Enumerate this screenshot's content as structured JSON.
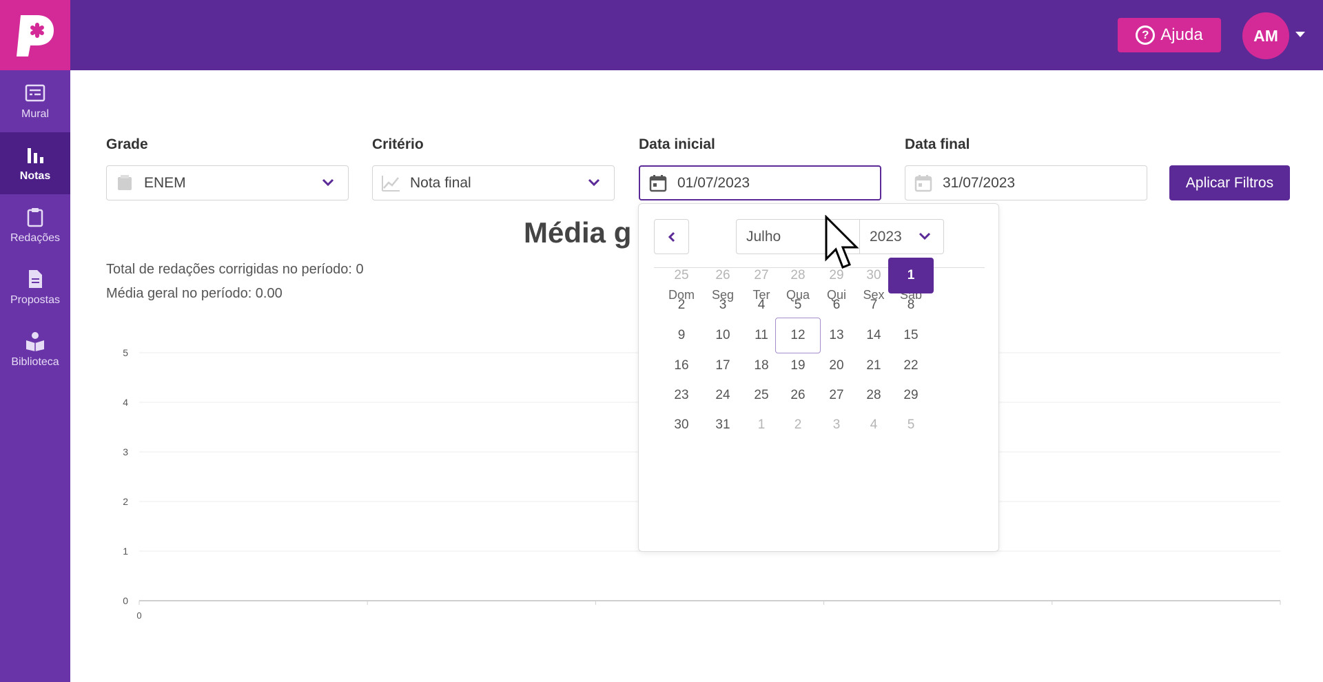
{
  "colors": {
    "brand_purple": "#5b2a96",
    "brand_pink": "#d42a97",
    "sidebar": "#6a34a9",
    "sidebar_active": "#4c1f86"
  },
  "header": {
    "logo": "P",
    "help_label": "Ajuda",
    "avatar_initials": "AM"
  },
  "sidebar": {
    "items": [
      {
        "label": "Mural",
        "icon": "board-icon"
      },
      {
        "label": "Notas",
        "icon": "bar-chart-icon",
        "active": true
      },
      {
        "label": "Redações",
        "icon": "clipboard-icon"
      },
      {
        "label": "Propostas",
        "icon": "document-icon"
      },
      {
        "label": "Biblioteca",
        "icon": "reader-icon"
      }
    ]
  },
  "filters": {
    "grade": {
      "label": "Grade",
      "value": "ENEM"
    },
    "criterio": {
      "label": "Critério",
      "value": "Nota final"
    },
    "data_inicial": {
      "label": "Data inicial",
      "value": "01/07/2023"
    },
    "data_final": {
      "label": "Data final",
      "value": "31/07/2023"
    },
    "apply_label": "Aplicar Filtros"
  },
  "main": {
    "chart_title": "Média g",
    "total_label": "Total de redações corrigidas no período: 0",
    "media_label": "Média geral no período: 0.00"
  },
  "chart_data": {
    "type": "line",
    "title": "",
    "xlabel": "",
    "ylabel": "",
    "ylim": [
      0,
      5
    ],
    "y_ticks": [
      "0",
      "1",
      "2",
      "3",
      "4",
      "5"
    ],
    "x_tick_labels": [
      "0"
    ],
    "grid": true,
    "series": []
  },
  "datepicker": {
    "month": "Julho",
    "year": "2023",
    "weekdays": [
      "Dom",
      "Seg",
      "Ter",
      "Qua",
      "Qui",
      "Sex",
      "Sáb"
    ],
    "weeks": [
      [
        [
          "25",
          "muted"
        ],
        [
          "26",
          "muted"
        ],
        [
          "27",
          "muted"
        ],
        [
          "28",
          "muted"
        ],
        [
          "29",
          "muted"
        ],
        [
          "30",
          "muted"
        ],
        [
          "1",
          "selected"
        ]
      ],
      [
        [
          "2",
          ""
        ],
        [
          "3",
          ""
        ],
        [
          "4",
          ""
        ],
        [
          "5",
          ""
        ],
        [
          "6",
          ""
        ],
        [
          "7",
          ""
        ],
        [
          "8",
          ""
        ]
      ],
      [
        [
          "9",
          ""
        ],
        [
          "10",
          ""
        ],
        [
          "11",
          ""
        ],
        [
          "12",
          "today"
        ],
        [
          "13",
          ""
        ],
        [
          "14",
          ""
        ],
        [
          "15",
          ""
        ]
      ],
      [
        [
          "16",
          ""
        ],
        [
          "17",
          ""
        ],
        [
          "18",
          ""
        ],
        [
          "19",
          ""
        ],
        [
          "20",
          ""
        ],
        [
          "21",
          ""
        ],
        [
          "22",
          ""
        ]
      ],
      [
        [
          "23",
          ""
        ],
        [
          "24",
          ""
        ],
        [
          "25",
          ""
        ],
        [
          "26",
          ""
        ],
        [
          "27",
          ""
        ],
        [
          "28",
          ""
        ],
        [
          "29",
          ""
        ]
      ],
      [
        [
          "30",
          ""
        ],
        [
          "31",
          ""
        ],
        [
          "1",
          "muted"
        ],
        [
          "2",
          "muted"
        ],
        [
          "3",
          "muted"
        ],
        [
          "4",
          "muted"
        ],
        [
          "5",
          "muted"
        ]
      ]
    ]
  }
}
